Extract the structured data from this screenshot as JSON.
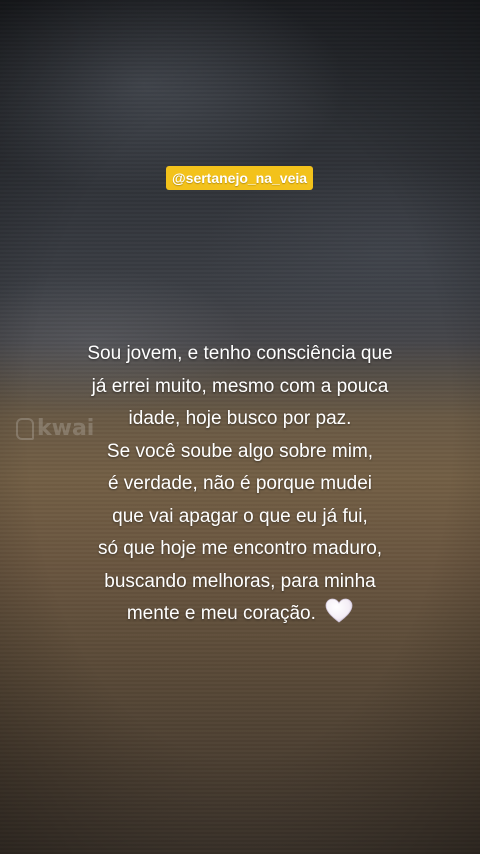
{
  "overlay": {
    "handle": "@sertanejo_na_veia",
    "watermark_text": "kwai"
  },
  "quote": {
    "lines": [
      "Sou jovem, e tenho consciência que",
      "já errei muito, mesmo com a pouca",
      "idade, hoje busco por paz.",
      "Se você soube algo sobre mim,",
      "é verdade, não é porque mudei",
      "que vai apagar o que eu já fui,",
      "só que hoje me encontro maduro,",
      "buscando melhoras, para minha",
      "mente e meu coração."
    ],
    "trailing_icon": "white-heart-icon"
  },
  "colors": {
    "badge_background": "#f3c21b",
    "text": "#ffffff",
    "heart": "#f4eef6"
  }
}
